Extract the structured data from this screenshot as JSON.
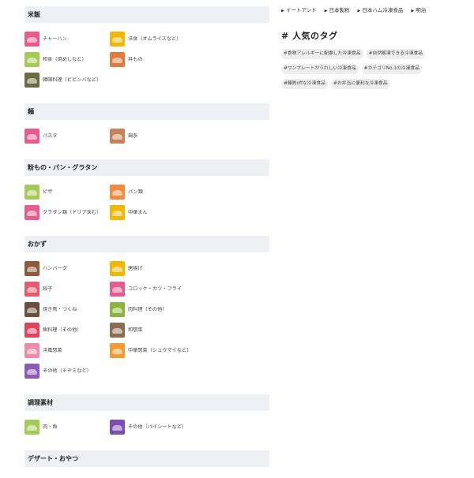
{
  "categories": [
    {
      "title": "米飯",
      "items": [
        {
          "label": "チャーハン",
          "color": "#e85b8c"
        },
        {
          "label": "洋食（オムライスなど）",
          "color": "#f2b705"
        },
        {
          "label": "和食（焼めしなど）",
          "color": "#a7c957"
        },
        {
          "label": "丼もの",
          "color": "#e07a3f"
        },
        {
          "label": "韓国料理（ビビンバなど）",
          "color": "#6b6c42"
        }
      ]
    },
    {
      "title": "麺",
      "items": [
        {
          "label": "パスタ",
          "color": "#e85b8c"
        },
        {
          "label": "鍋系",
          "color": "#c7825a"
        }
      ]
    },
    {
      "title": "粉もの・パン・グラタン",
      "items": [
        {
          "label": "ピザ",
          "color": "#a7c957"
        },
        {
          "label": "パン類",
          "color": "#f08a3c"
        },
        {
          "label": "グラタン類（ドリア含む）",
          "color": "#e85b8c"
        },
        {
          "label": "中華まん",
          "color": "#f2b705"
        }
      ]
    },
    {
      "title": "おかず",
      "items": [
        {
          "label": "ハンバーグ",
          "color": "#8d5a3b"
        },
        {
          "label": "唐揚げ",
          "color": "#f2b705"
        },
        {
          "label": "餃子",
          "color": "#e85b6c"
        },
        {
          "label": "コロッケ・カツ・フライ",
          "color": "#e85b8c"
        },
        {
          "label": "焼き鳥・つくね",
          "color": "#6b4e3d"
        },
        {
          "label": "肉料理（その他）",
          "color": "#8cb33c"
        },
        {
          "label": "魚料理（その他）",
          "color": "#e0435b"
        },
        {
          "label": "和惣菜",
          "color": "#8a6d52"
        },
        {
          "label": "洋風惣菜",
          "color": "#ef8aa8"
        },
        {
          "label": "中華惣菜（シュウマイなど）",
          "color": "#f29a2e"
        },
        {
          "label": "その他（チヂミなど）",
          "color": "#8e5ab5"
        }
      ]
    },
    {
      "title": "調理素材",
      "items": [
        {
          "label": "肉・魚",
          "color": "#a7c957"
        },
        {
          "label": "その他（パイシートなど）",
          "color": "#7a4fb0"
        }
      ]
    }
  ],
  "next_category": "デザート・おやつ",
  "brands": [
    "イートアンド",
    "日本製粉",
    "日本ハム冷凍食品",
    "明治"
  ],
  "arrow": "▶",
  "tags_title": "# 人気のタグ",
  "tags": [
    "#食物アレルギーに配慮した冷凍食品",
    "#自然解凍できる冷凍食品",
    "#ワンプレートがうれしい冷凍食品",
    "#カテゴリNo.1の冷凍食品",
    "#糖質offな冷凍食品",
    "#お弁当に便利な冷凍食品"
  ]
}
